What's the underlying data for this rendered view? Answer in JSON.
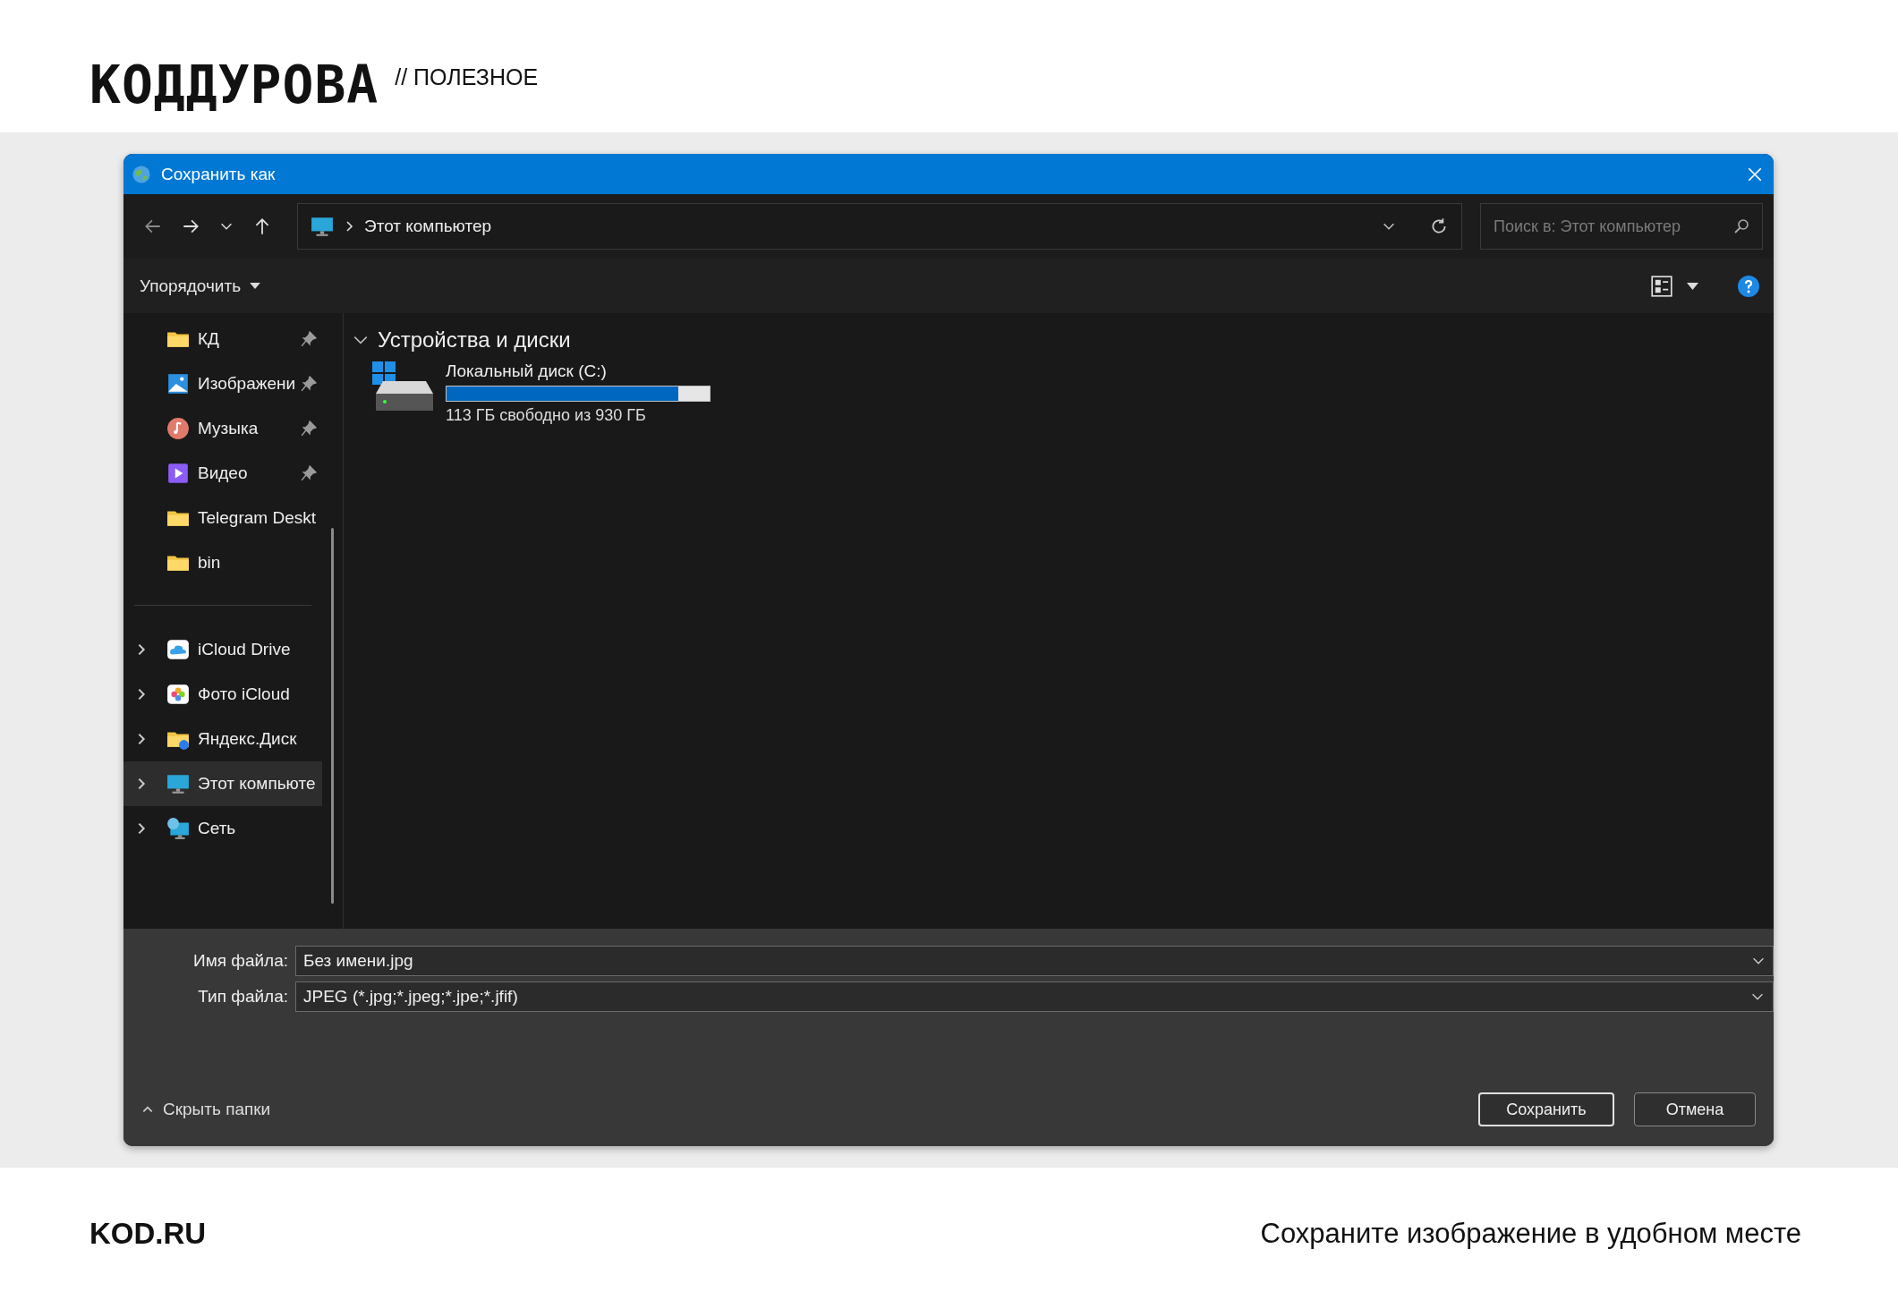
{
  "header": {
    "logo": "КОДДУРОВА",
    "tag": "// ПОЛЕЗНОЕ"
  },
  "dialog": {
    "title": "Сохранить как",
    "address": {
      "crumb": "Этот компьютер"
    },
    "search": {
      "placeholder": "Поиск в: Этот компьютер"
    },
    "toolbar": {
      "organize": "Упорядочить"
    },
    "quick_access": [
      {
        "label": "КД",
        "kind": "folder",
        "pinned": true,
        "selected": false
      },
      {
        "label": "Изображени",
        "kind": "pictures",
        "pinned": true,
        "selected": false
      },
      {
        "label": "Музыка",
        "kind": "music",
        "pinned": true,
        "selected": false
      },
      {
        "label": "Видео",
        "kind": "video",
        "pinned": true,
        "selected": false
      },
      {
        "label": "Telegram Deskt",
        "kind": "folder",
        "pinned": false,
        "selected": false
      },
      {
        "label": "bin",
        "kind": "folder",
        "pinned": false,
        "selected": false
      }
    ],
    "locations": [
      {
        "label": "iCloud Drive",
        "kind": "cloud",
        "expanded": false,
        "selected": false
      },
      {
        "label": "Фото iCloud",
        "kind": "photos",
        "expanded": false,
        "selected": false
      },
      {
        "label": "Яндекс.Диск",
        "kind": "yandex",
        "expanded": false,
        "selected": false
      },
      {
        "label": "Этот компьюте",
        "kind": "pc",
        "expanded": false,
        "selected": true
      },
      {
        "label": "Сеть",
        "kind": "network",
        "expanded": false,
        "selected": false
      }
    ],
    "group": {
      "title": "Устройства и диски",
      "expanded": true
    },
    "drives": [
      {
        "name": "Локальный диск (C:)",
        "level": 0.88,
        "free": "113 ГБ свободно из 930 ГБ"
      }
    ],
    "filename": {
      "label": "Имя файла:",
      "value": "Без имени.jpg"
    },
    "filetype": {
      "label": "Тип файла:",
      "value": "JPEG (*.jpg;*.jpeg;*.jpe;*.jfif)"
    },
    "hide_folders": "Скрыть папки",
    "buttons": [
      {
        "label": "Сохранить",
        "default": true
      },
      {
        "label": "Отмена",
        "default": false
      }
    ]
  },
  "footer": {
    "site": "KOD.RU",
    "caption": "Сохраните изображение в удобном месте"
  }
}
